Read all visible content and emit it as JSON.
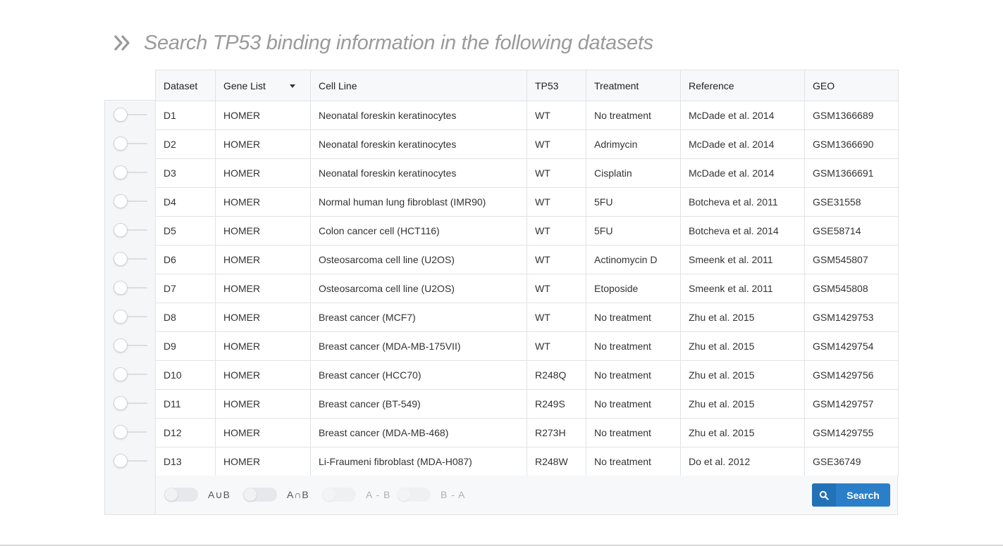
{
  "heading": {
    "title": "Search TP53 binding information in the following datasets",
    "icon": "double-chevron-right-icon"
  },
  "table": {
    "columns": [
      "Dataset",
      "Gene List",
      "Cell Line",
      "TP53",
      "Treatment",
      "Reference",
      "GEO"
    ],
    "rows": [
      {
        "dataset": "D1",
        "gene_list": "HOMER",
        "cell_line": "Neonatal foreskin keratinocytes",
        "tp53": "WT",
        "treatment": "No treatment",
        "reference": "McDade et al. 2014",
        "geo": "GSM1366689"
      },
      {
        "dataset": "D2",
        "gene_list": "HOMER",
        "cell_line": "Neonatal foreskin keratinocytes",
        "tp53": "WT",
        "treatment": "Adrimycin",
        "reference": "McDade et al. 2014",
        "geo": "GSM1366690"
      },
      {
        "dataset": "D3",
        "gene_list": "HOMER",
        "cell_line": "Neonatal foreskin keratinocytes",
        "tp53": "WT",
        "treatment": "Cisplatin",
        "reference": "McDade et al. 2014",
        "geo": "GSM1366691"
      },
      {
        "dataset": "D4",
        "gene_list": "HOMER",
        "cell_line": "Normal human lung fibroblast (IMR90)",
        "tp53": "WT",
        "treatment": "5FU",
        "reference": "Botcheva et al. 2011",
        "geo": "GSE31558"
      },
      {
        "dataset": "D5",
        "gene_list": "HOMER",
        "cell_line": "Colon cancer cell (HCT116)",
        "tp53": "WT",
        "treatment": "5FU",
        "reference": "Botcheva et al. 2014",
        "geo": "GSE58714"
      },
      {
        "dataset": "D6",
        "gene_list": "HOMER",
        "cell_line": "Osteosarcoma cell line (U2OS)",
        "tp53": "WT",
        "treatment": "Actinomycin D",
        "reference": "Smeenk et al. 2011",
        "geo": "GSM545807"
      },
      {
        "dataset": "D7",
        "gene_list": "HOMER",
        "cell_line": "Osteosarcoma cell line (U2OS)",
        "tp53": "WT",
        "treatment": "Etoposide",
        "reference": "Smeenk et al. 2011",
        "geo": "GSM545808"
      },
      {
        "dataset": "D8",
        "gene_list": "HOMER",
        "cell_line": "Breast cancer (MCF7)",
        "tp53": "WT",
        "treatment": "No treatment",
        "reference": "Zhu et al. 2015",
        "geo": "GSM1429753"
      },
      {
        "dataset": "D9",
        "gene_list": "HOMER",
        "cell_line": "Breast cancer (MDA-MB-175VII)",
        "tp53": "WT",
        "treatment": "No treatment",
        "reference": "Zhu et al. 2015",
        "geo": "GSM1429754"
      },
      {
        "dataset": "D10",
        "gene_list": "HOMER",
        "cell_line": "Breast cancer (HCC70)",
        "tp53": "R248Q",
        "treatment": "No treatment",
        "reference": "Zhu et al. 2015",
        "geo": "GSM1429756"
      },
      {
        "dataset": "D11",
        "gene_list": "HOMER",
        "cell_line": "Breast cancer (BT-549)",
        "tp53": "R249S",
        "treatment": "No treatment",
        "reference": "Zhu et al. 2015",
        "geo": "GSM1429757"
      },
      {
        "dataset": "D12",
        "gene_list": "HOMER",
        "cell_line": "Breast cancer (MDA-MB-468)",
        "tp53": "R273H",
        "treatment": "No treatment",
        "reference": "Zhu et al. 2015",
        "geo": "GSM1429755"
      },
      {
        "dataset": "D13",
        "gene_list": "HOMER",
        "cell_line": "Li-Fraumeni fibroblast (MDA-H087)",
        "tp53": "R248W",
        "treatment": "No treatment",
        "reference": "Do et al. 2012",
        "geo": "GSE36749"
      }
    ]
  },
  "set_operations": [
    {
      "label": "A∪B",
      "enabled": true
    },
    {
      "label": "A∩B",
      "enabled": true
    },
    {
      "label": "A - B",
      "enabled": false
    },
    {
      "label": "B - A",
      "enabled": false
    }
  ],
  "search_button": {
    "label": "Search",
    "icon": "search-icon"
  },
  "colors": {
    "link": "#4a7bbf",
    "button": "#2b7fc8",
    "muted": "#c2c2c2"
  }
}
